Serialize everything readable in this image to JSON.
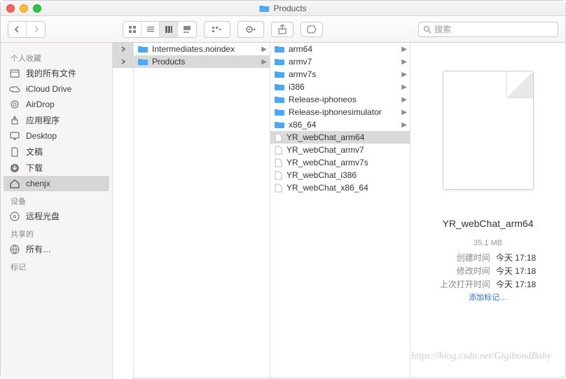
{
  "window": {
    "title": "Products"
  },
  "toolbar": {
    "search_placeholder": "搜索"
  },
  "sidebar": {
    "sections": [
      {
        "header": "个人收藏",
        "items": [
          {
            "label": "我的所有文件",
            "icon": "all-files-icon"
          },
          {
            "label": "iCloud Drive",
            "icon": "cloud-icon"
          },
          {
            "label": "AirDrop",
            "icon": "airdrop-icon"
          },
          {
            "label": "应用程序",
            "icon": "apps-icon"
          },
          {
            "label": "Desktop",
            "icon": "desktop-icon"
          },
          {
            "label": "文稿",
            "icon": "documents-icon"
          },
          {
            "label": "下载",
            "icon": "downloads-icon"
          },
          {
            "label": "chenjx",
            "icon": "home-icon",
            "selected": true
          }
        ]
      },
      {
        "header": "设备",
        "items": [
          {
            "label": "远程光盘",
            "icon": "disc-icon"
          }
        ]
      },
      {
        "header": "共享的",
        "items": [
          {
            "label": "所有…",
            "icon": "network-icon"
          }
        ]
      },
      {
        "header": "标记",
        "items": []
      }
    ]
  },
  "columns": {
    "col2": [
      {
        "label": "Intermediates.noindex",
        "type": "folder",
        "hasChildren": true
      },
      {
        "label": "Products",
        "type": "folder",
        "hasChildren": true,
        "selected": true
      }
    ],
    "col3": [
      {
        "label": "arm64",
        "type": "folder",
        "hasChildren": true
      },
      {
        "label": "armv7",
        "type": "folder",
        "hasChildren": true
      },
      {
        "label": "armv7s",
        "type": "folder",
        "hasChildren": true
      },
      {
        "label": "i386",
        "type": "folder",
        "hasChildren": true
      },
      {
        "label": "Release-iphoneos",
        "type": "folder",
        "hasChildren": true
      },
      {
        "label": "Release-iphonesimulator",
        "type": "folder",
        "hasChildren": true
      },
      {
        "label": "x86_64",
        "type": "folder",
        "hasChildren": true
      },
      {
        "label": "YR_webChat_arm64",
        "type": "file",
        "selected": true
      },
      {
        "label": "YR_webChat_armv7",
        "type": "file"
      },
      {
        "label": "YR_webChat_armv7s",
        "type": "file"
      },
      {
        "label": "YR_webChat_i386",
        "type": "file"
      },
      {
        "label": "YR_webChat_x86_64",
        "type": "file"
      }
    ]
  },
  "preview": {
    "name": "YR_webChat_arm64",
    "size": "35.1 MB",
    "created_label": "创建时间",
    "created_value": "今天 17:18",
    "modified_label": "修改时间",
    "modified_value": "今天 17:18",
    "opened_label": "上次打开时间",
    "opened_value": "今天 17:18",
    "add_tags": "添加标记…"
  },
  "watermark": "https://blog.csdn.net/GigibondBaby"
}
